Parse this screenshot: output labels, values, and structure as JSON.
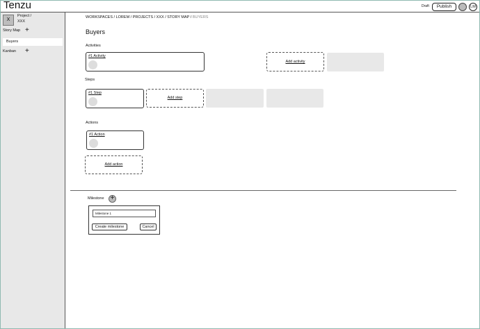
{
  "header": {
    "brand": "Tenzu",
    "status": "Draft",
    "publish_label": "Publish",
    "user_initials": "LM"
  },
  "sidebar": {
    "project_tile": "X",
    "project_line1": "Project /",
    "project_line2": "XXX",
    "story_map_label": "Story Map",
    "story_map_sub": "Buyers",
    "kanban_label": "Kanban",
    "plus_glyph": "+"
  },
  "breadcrumb": {
    "path": "WORKSPACES / LOREM / PROJECTS / XXX / STORY MAP /",
    "current": " BUYERS"
  },
  "page": {
    "title": "Buyers"
  },
  "activities": {
    "label": "Activities",
    "card_title": "#1 Activity",
    "add_label": "Add activity"
  },
  "steps": {
    "label": "Steps",
    "card_title": "#1 Step",
    "add_label": "Add step"
  },
  "actions": {
    "label": "Actions",
    "card_title": "#1 Action",
    "add_label": "Add action"
  },
  "milestone": {
    "label": "Milestone",
    "input_value": "Milestone 1",
    "create_label": "Create milestone",
    "cancel_label": "Cancel"
  }
}
